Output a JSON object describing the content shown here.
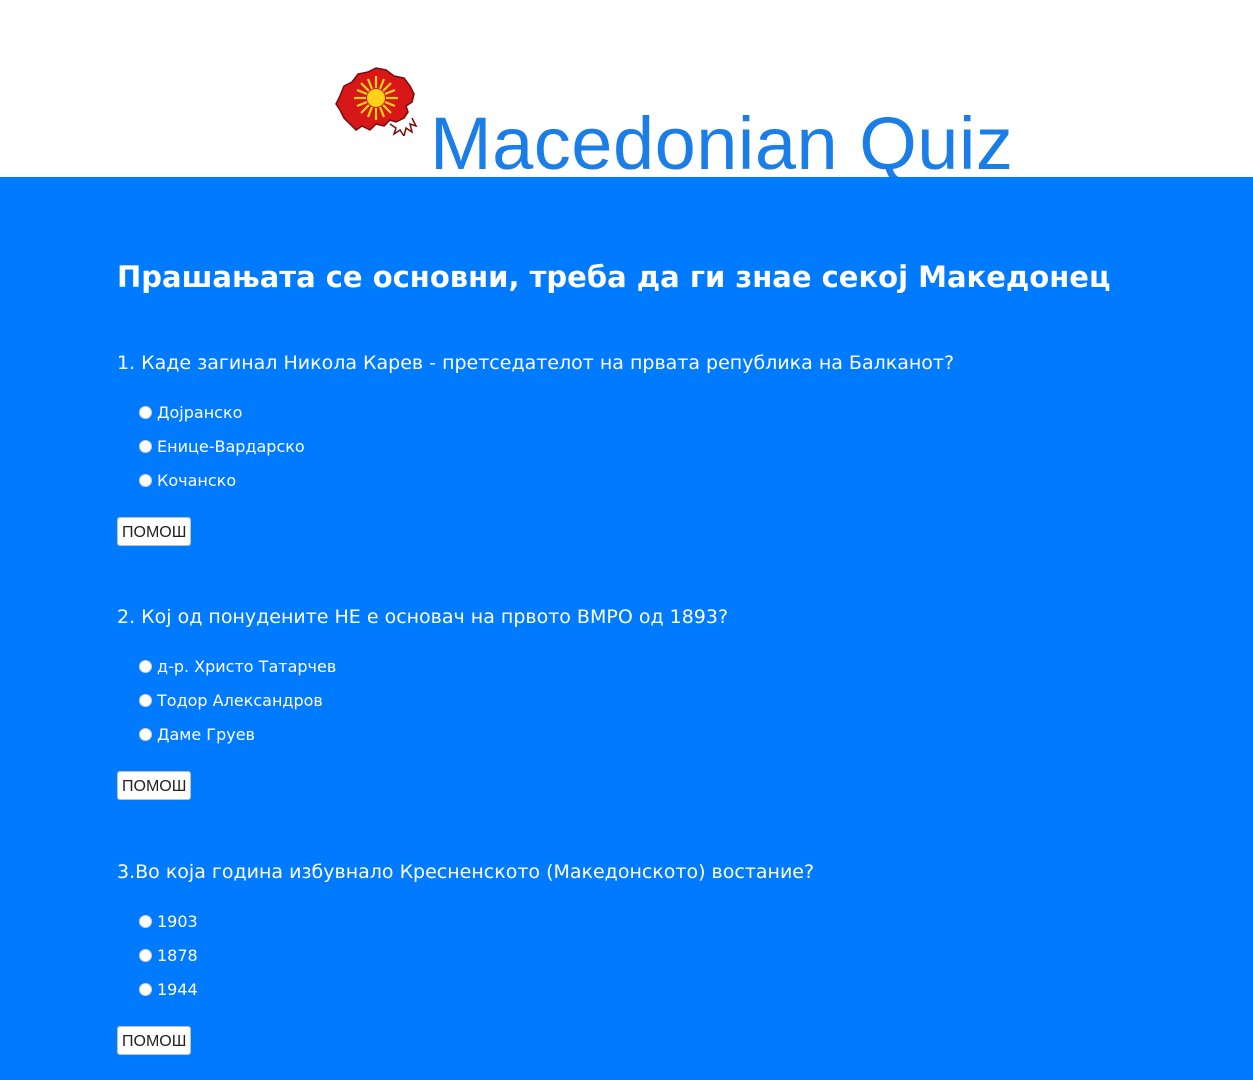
{
  "header": {
    "title": "Macedonian Quiz",
    "logo_icon": "macedonia-map-sun-icon",
    "title_color": "#1a7ee6"
  },
  "main": {
    "background": "#007bff",
    "subtitle": "Прашањата се основни, треба да ги знае секој Македонец",
    "questions": [
      {
        "text": "1. Каде загинал Никола Карев - претседателот на првата република на Балканот?",
        "options": [
          "Дојранско",
          "Енице-Вардарско",
          "Кочанско"
        ],
        "help_label": "ПОМОШ"
      },
      {
        "text": "2. Кој од понудените НЕ е основач на првото ВМРО од 1893?",
        "options": [
          "д-р. Христо Татарчев",
          "Тодор Александров",
          "Даме Груев"
        ],
        "help_label": "ПОМОШ"
      },
      {
        "text": "3.Во која година избувнало Кресненското (Македонското) востание?",
        "options": [
          "1903",
          "1878",
          "1944"
        ],
        "help_label": "ПОМОШ"
      }
    ]
  }
}
